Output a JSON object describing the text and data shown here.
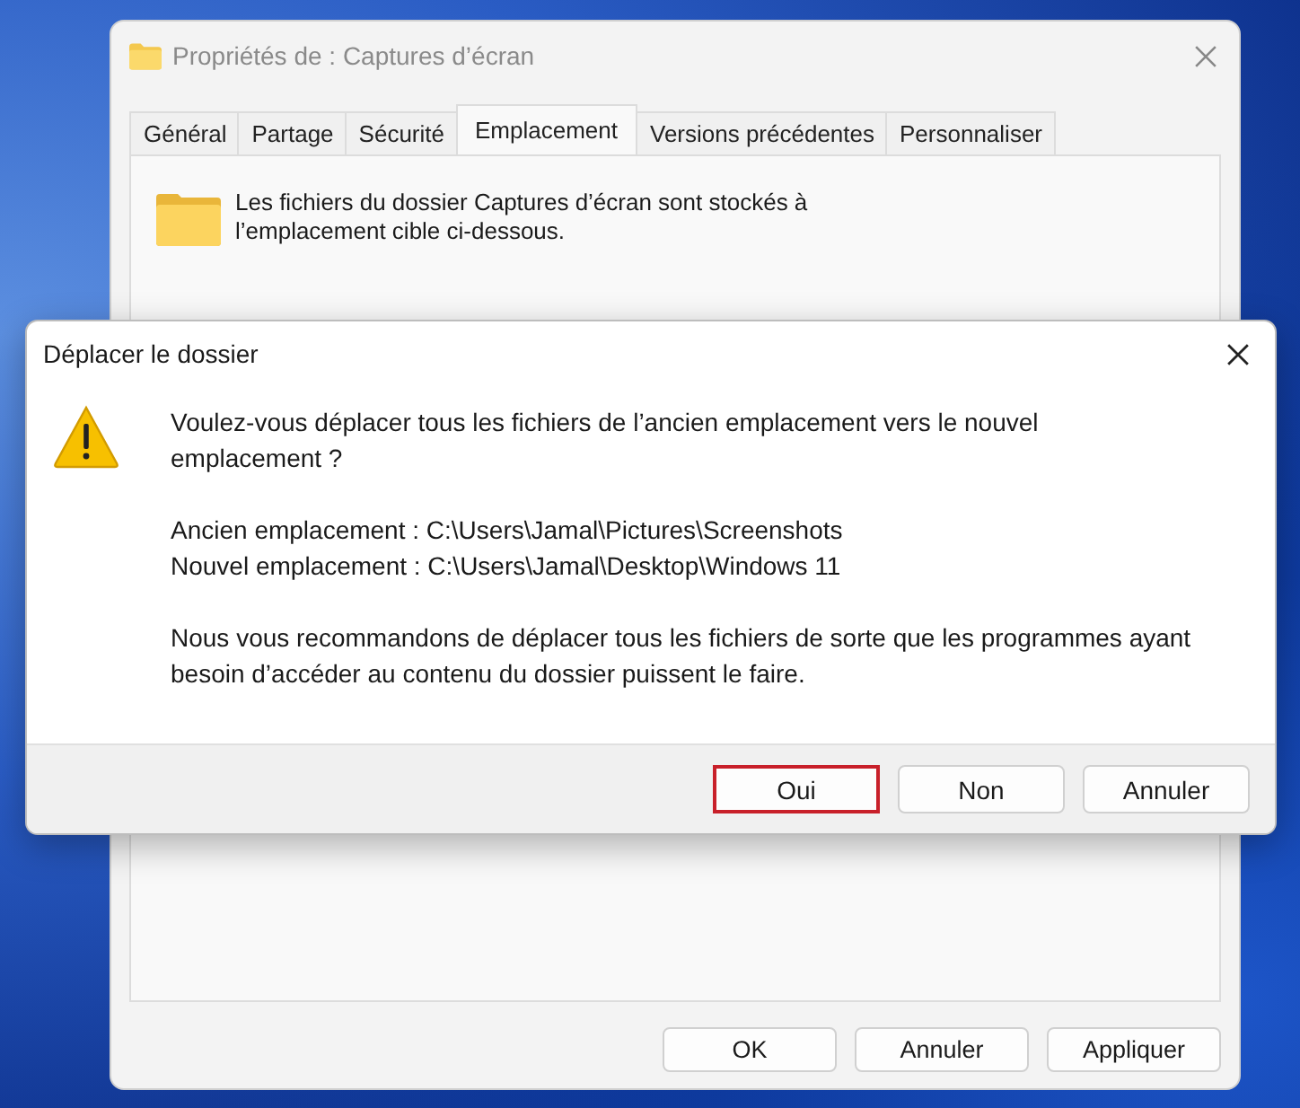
{
  "properties_window": {
    "title": "Propriétés de : Captures d’écran",
    "tabs": [
      {
        "label": "Général",
        "selected": false
      },
      {
        "label": "Partage",
        "selected": false
      },
      {
        "label": "Sécurité",
        "selected": false
      },
      {
        "label": "Emplacement",
        "selected": true
      },
      {
        "label": "Versions précédentes",
        "selected": false
      },
      {
        "label": "Personnaliser",
        "selected": false
      }
    ],
    "info_text": "Les fichiers du dossier Captures d’écran sont stockés à l’emplacement cible ci-dessous.",
    "buttons": [
      {
        "label": "OK",
        "highlighted": false
      },
      {
        "label": "Annuler",
        "highlighted": false
      },
      {
        "label": "Appliquer",
        "highlighted": false
      }
    ]
  },
  "dialog": {
    "title": "Déplacer le dossier",
    "question": "Voulez-vous déplacer tous les fichiers de l’ancien emplacement vers le nouvel emplacement ?",
    "old_location": "Ancien emplacement : C:\\Users\\Jamal\\Pictures\\Screenshots",
    "new_location": "Nouvel emplacement : C:\\Users\\Jamal\\Desktop\\Windows 11",
    "recommendation": "Nous vous recommandons de déplacer tous les fichiers de sorte que les programmes ayant besoin d’accéder au contenu du dossier puissent le faire.",
    "buttons": [
      {
        "label": "Oui",
        "highlighted": true
      },
      {
        "label": "Non",
        "highlighted": false
      },
      {
        "label": "Annuler",
        "highlighted": false
      }
    ]
  }
}
